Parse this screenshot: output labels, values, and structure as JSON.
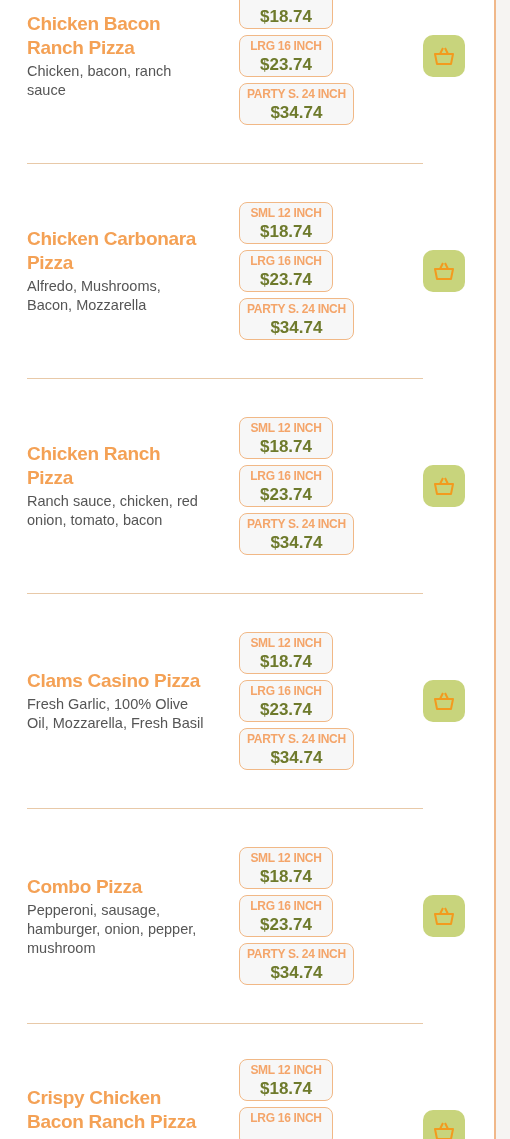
{
  "menu_items": [
    {
      "name": "Chicken Bacon Ranch Pizza",
      "description": "Chicken, bacon, ranch sauce",
      "sizes": [
        {
          "price": "$18.74"
        },
        {
          "label": "LRG 16 INCH",
          "price": "$23.74"
        },
        {
          "label": "PARTY S. 24 INCH",
          "price": "$34.74"
        }
      ]
    },
    {
      "name": "Chicken Carbonara Pizza",
      "description": "Alfredo, Mushrooms, Bacon, Mozzarella",
      "sizes": [
        {
          "label": "SML 12 INCH",
          "price": "$18.74"
        },
        {
          "label": "LRG 16 INCH",
          "price": "$23.74"
        },
        {
          "label": "PARTY S. 24 INCH",
          "price": "$34.74"
        }
      ]
    },
    {
      "name": "Chicken Ranch Pizza",
      "description": "Ranch sauce, chicken, red onion, tomato, bacon",
      "sizes": [
        {
          "label": "SML 12 INCH",
          "price": "$18.74"
        },
        {
          "label": "LRG 16 INCH",
          "price": "$23.74"
        },
        {
          "label": "PARTY S. 24 INCH",
          "price": "$34.74"
        }
      ]
    },
    {
      "name": "Clams Casino Pizza",
      "description": "Fresh Garlic, 100% Olive Oil, Mozzarella, Fresh Basil",
      "sizes": [
        {
          "label": "SML 12 INCH",
          "price": "$18.74"
        },
        {
          "label": "LRG 16 INCH",
          "price": "$23.74"
        },
        {
          "label": "PARTY S. 24 INCH",
          "price": "$34.74"
        }
      ]
    },
    {
      "name": "Combo Pizza",
      "description": "Pepperoni, sausage, hamburger, onion, pepper, mushroom",
      "sizes": [
        {
          "label": "SML 12 INCH",
          "price": "$18.74"
        },
        {
          "label": "LRG 16 INCH",
          "price": "$23.74"
        },
        {
          "label": "PARTY S. 24 INCH",
          "price": "$34.74"
        }
      ]
    },
    {
      "name": "Crispy Chicken Bacon Ranch Pizza",
      "sizes": [
        {
          "label": "SML 12 INCH",
          "price": "$18.74"
        },
        {
          "label": "LRG 16 INCH"
        }
      ]
    }
  ]
}
